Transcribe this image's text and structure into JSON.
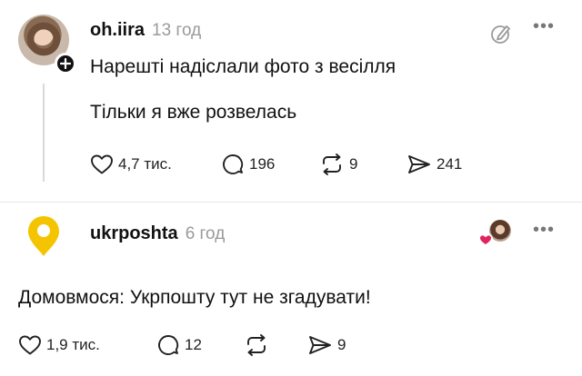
{
  "posts": [
    {
      "username": "oh.iira",
      "time": "13 год",
      "lines": [
        "Нарешті надіслали фото з весілля",
        "Тільки я вже розвелась"
      ],
      "likes": "4,7 тис.",
      "comments": "196",
      "reposts": "9",
      "shares": "241"
    },
    {
      "username": "ukrposhta",
      "time": "6 год",
      "lines": [
        "Домовмося: Укрпошту тут не згадувати!"
      ],
      "likes": "1,9 тис.",
      "comments": "12",
      "reposts": "",
      "shares": "9"
    }
  ],
  "colors": {
    "brand_yellow": "#f5c400",
    "heart_red": "#e0245e",
    "muted": "#9a9a9a"
  },
  "icons": [
    "heart-icon",
    "comment-icon",
    "repost-icon",
    "send-icon",
    "more-icon",
    "edit-icon",
    "plus-icon",
    "ukrposhta-logo"
  ]
}
